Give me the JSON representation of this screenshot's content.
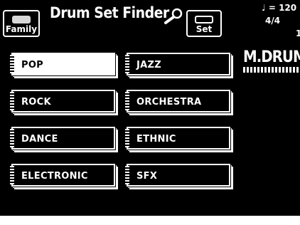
{
  "header": {
    "family_label": "Family",
    "title": "Drum Set Finder",
    "set_label": "Set"
  },
  "status": {
    "tempo": "♩ = 120",
    "time_signature": "4/4",
    "bar": "1"
  },
  "brand": "M.DRUMS",
  "categories": [
    {
      "label": "POP",
      "selected": true
    },
    {
      "label": "JAZZ",
      "selected": false
    },
    {
      "label": "ROCK",
      "selected": false
    },
    {
      "label": "ORCHESTRA",
      "selected": false
    },
    {
      "label": "DANCE",
      "selected": false
    },
    {
      "label": "ETHNIC",
      "selected": false
    },
    {
      "label": "ELECTRONIC",
      "selected": false
    },
    {
      "label": "SFX",
      "selected": false
    }
  ],
  "colors": {
    "background": "#000000",
    "foreground": "#ffffff"
  }
}
